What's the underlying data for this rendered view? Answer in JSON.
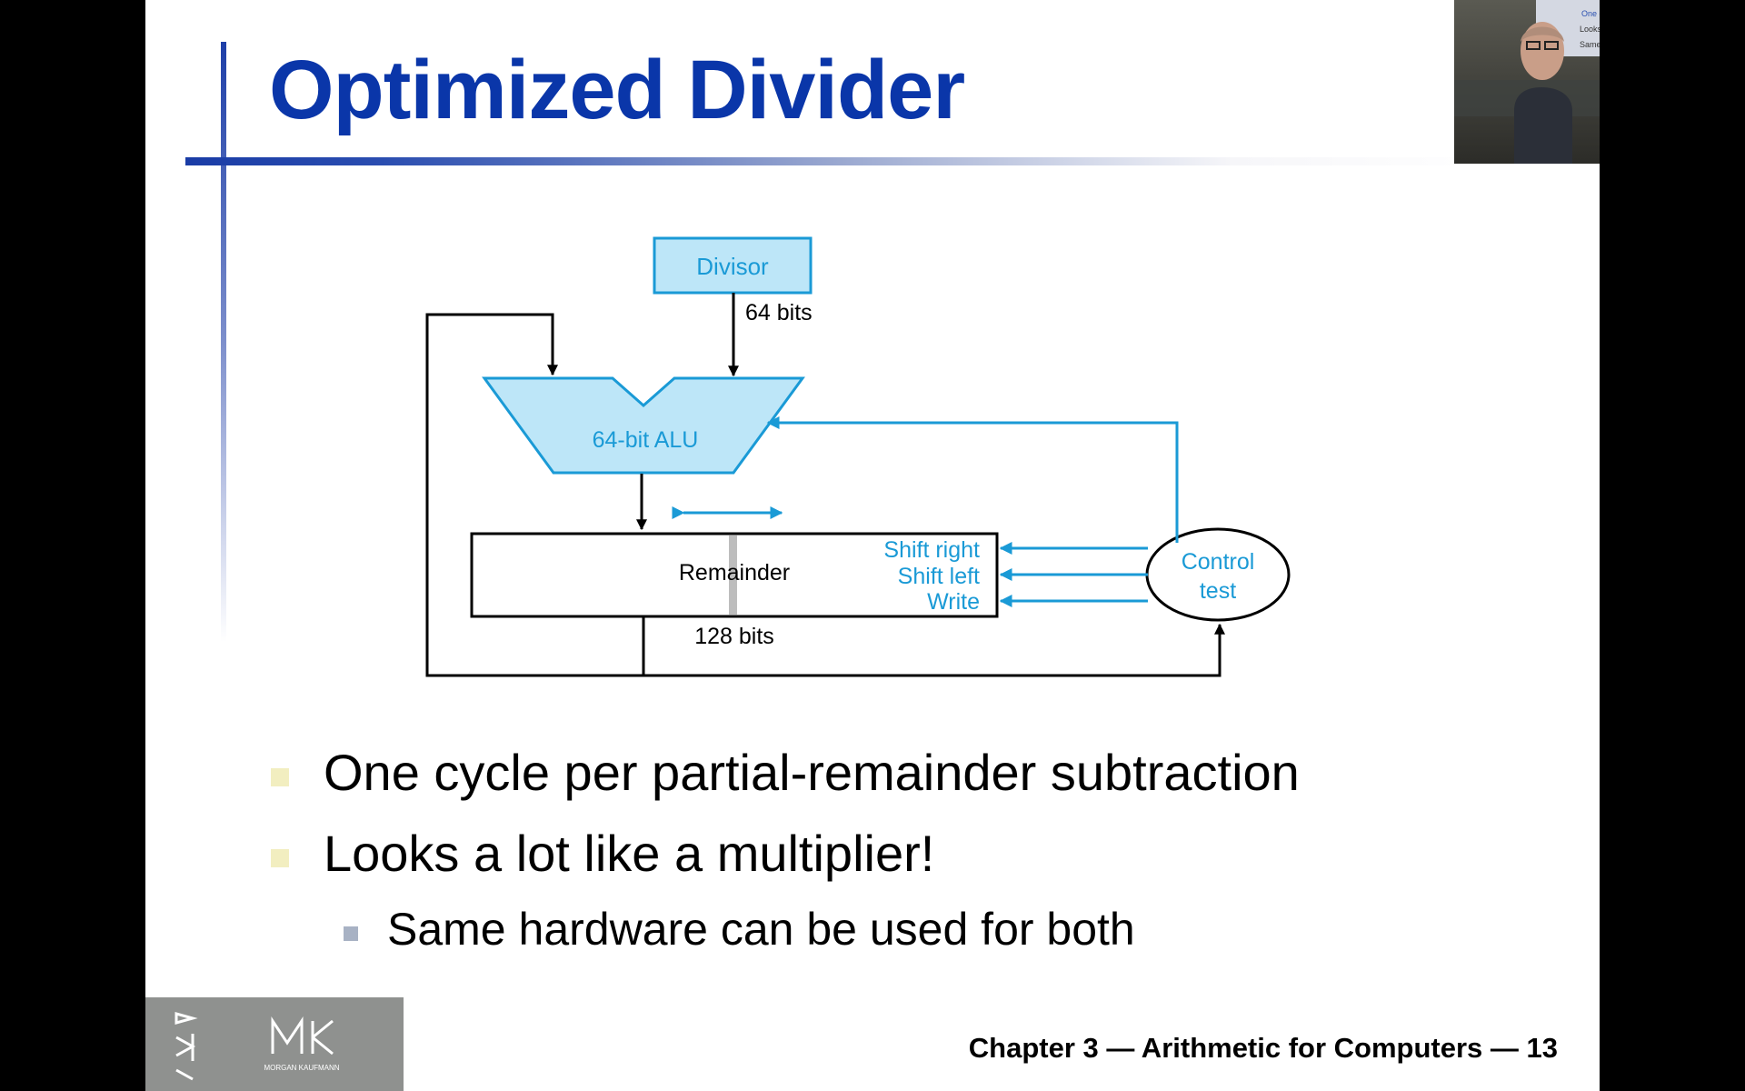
{
  "slide": {
    "title": "Optimized Divider",
    "diagram": {
      "divisor_label": "Divisor",
      "divisor_width": "64 bits",
      "alu_label": "64-bit ALU",
      "remainder_label": "Remainder",
      "remainder_width": "128 bits",
      "shift_right": "Shift right",
      "shift_left": "Shift left",
      "write": "Write",
      "control_line1": "Control",
      "control_line2": "test"
    },
    "bullets": [
      "One cycle per partial-remainder subtraction",
      "Looks a lot like a multiplier!"
    ],
    "sub_bullets": [
      "Same hardware can be used for both"
    ],
    "footer": "Chapter 3 — Arithmetic for Computers — 13",
    "logo_text": "MORGAN KAUFMANN"
  },
  "webcam": {
    "slide_text_1": "One cycle per partial-remaind",
    "slide_text_2": "Looks a lot like a multiplier!",
    "slide_text_3": "Same hardware can be used"
  },
  "colors": {
    "title": "#0a36a9",
    "diagram_blue": "#1a9ad6",
    "diagram_fill": "#bde6f8"
  }
}
